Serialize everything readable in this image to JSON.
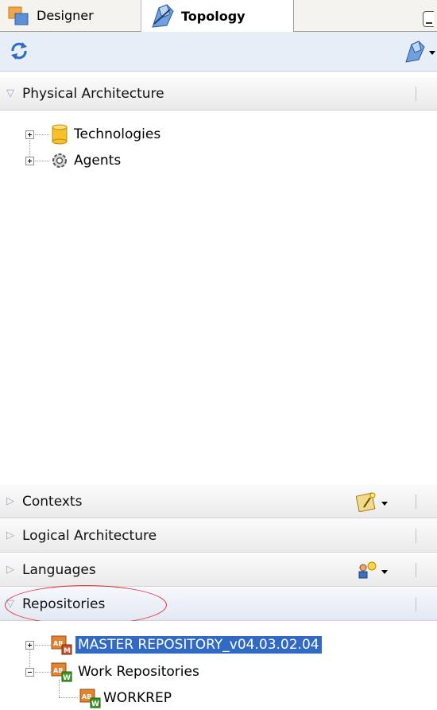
{
  "tabs": {
    "designer": "Designer",
    "topology": "Topology"
  },
  "toolbar": {
    "refresh_icon": "refresh-icon",
    "topology_menu_icon": "topology-icon"
  },
  "sections": {
    "physical_architecture": {
      "title": "Physical Architecture",
      "expanded": true
    },
    "contexts": {
      "title": "Contexts",
      "expanded": false
    },
    "logical_architecture": {
      "title": "Logical Architecture",
      "expanded": false
    },
    "languages": {
      "title": "Languages",
      "expanded": false
    },
    "repositories": {
      "title": "Repositories",
      "expanded": true,
      "highlighted": true
    }
  },
  "physical_tree": [
    {
      "label": "Technologies",
      "icon": "database-icon"
    },
    {
      "label": "Agents",
      "icon": "gear-icon"
    }
  ],
  "repositories_tree": {
    "master": "MASTER REPOSITORY_v04.03.02.04",
    "work_group": "Work Repositories",
    "work_items": [
      "WORKREP"
    ]
  },
  "colors": {
    "selection": "#316ac5",
    "annotation_circle": "#e83030",
    "toolbar_bg": "#e8eef7"
  }
}
